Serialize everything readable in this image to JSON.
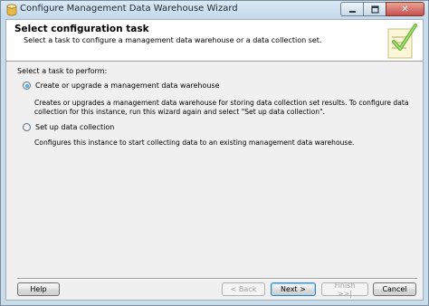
{
  "window": {
    "title": "Configure Management Data Warehouse Wizard",
    "close_label": "✕"
  },
  "header": {
    "title": "Select configuration task",
    "subtitle": "Select a task to configure a management data warehouse or a data collection set."
  },
  "main": {
    "prompt": "Select a task to perform:",
    "options": [
      {
        "label": "Create or upgrade a management data warehouse",
        "checked": true,
        "description": "Creates or upgrades a management data warehouse for storing data collection set results. To configure data collection for this instance, run this wizard again and select \"Set up data collection\"."
      },
      {
        "label": "Set up data collection",
        "checked": false,
        "description": "Configures this instance to start collecting data to an existing management data warehouse."
      }
    ]
  },
  "footer": {
    "help_label": "Help",
    "back_label": "< Back",
    "next_label": "Next >",
    "finish_label": "Finish >>|",
    "cancel_label": "Cancel"
  },
  "colors": {
    "title_bar": "#c9dcea",
    "close_button": "#c75050",
    "client_bg": "#f0f0f0"
  }
}
